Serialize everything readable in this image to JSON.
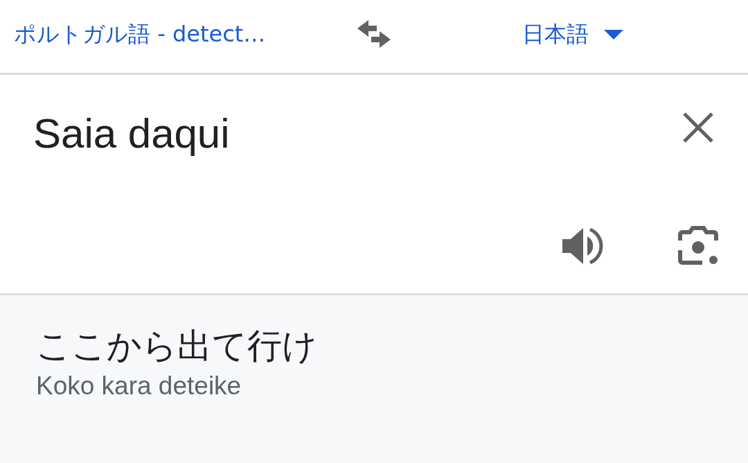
{
  "source_language": {
    "label": "ポルトガル語 - detect…"
  },
  "target_language": {
    "label": "日本語"
  },
  "input": {
    "value": "Saia daqui"
  },
  "translation": {
    "text": "ここから出て行け",
    "romanization": "Koko kara deteike"
  }
}
